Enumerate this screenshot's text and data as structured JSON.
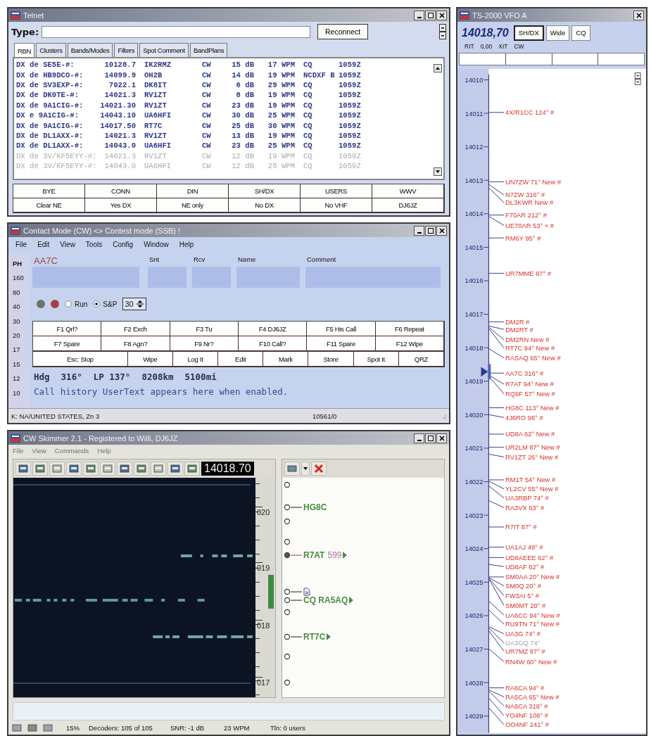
{
  "telnet": {
    "title": "Telnet",
    "type_label": "Type:",
    "reconnect": "Reconnect",
    "tabs": [
      {
        "label": "RBN",
        "selected": true
      },
      {
        "label": "Clusters",
        "selected": false
      },
      {
        "label": "Bands/Modes",
        "selected": false
      },
      {
        "label": "Filters",
        "selected": false
      },
      {
        "label": "Spot Comment",
        "selected": false
      },
      {
        "label": "BandPlans",
        "selected": false
      }
    ],
    "spots": [
      {
        "spotter": "DX de SE5E-#:",
        "freq": "10128.7",
        "call": "IK2RMZ",
        "mode": "CW",
        "snr": "15 dB",
        "speed": "17 WPM",
        "type": "CQ",
        "time": "1059Z",
        "faded": false
      },
      {
        "spotter": "DX de HB9DCO-#:",
        "freq": "14099.9",
        "call": "OH2B",
        "mode": "CW",
        "snr": "14 dB",
        "speed": "19 WPM",
        "type": "NCDXF B",
        "time": "1059Z",
        "faded": false
      },
      {
        "spotter": "DX de SV3EXP-#:",
        "freq": "7022.1",
        "call": "DK8IT",
        "mode": "CW",
        "snr": "6 dB",
        "speed": "29 WPM",
        "type": "CQ",
        "time": "1059Z",
        "faded": false
      },
      {
        "spotter": "DX de DK0TE-#:",
        "freq": "14021.3",
        "call": "RV1ZT",
        "mode": "CW",
        "snr": "8 dB",
        "speed": "19 WPM",
        "type": "CQ",
        "time": "1059Z",
        "faded": false
      },
      {
        "spotter": "DX de 9A1CIG-#:",
        "freq": "14021.30",
        "call": "RV1ZT",
        "mode": "CW",
        "snr": "23 dB",
        "speed": "19 WPM",
        "type": "CQ",
        "time": "1059Z",
        "faded": false
      },
      {
        "spotter": "DX  e 9A1CIG-#:",
        "freq": "14043.10",
        "call": "UA6HFI",
        "mode": "CW",
        "snr": "30 dB",
        "speed": "25 WPM",
        "type": "CQ",
        "time": "1059Z",
        "faded": false
      },
      {
        "spotter": "DX de 9A1CIG-#:",
        "freq": "14017.50",
        "call": "RT7C",
        "mode": "CW",
        "snr": "25 dB",
        "speed": "30 WPM",
        "type": "CQ",
        "time": "1059Z",
        "faded": false
      },
      {
        "spotter": "DX de DL1AXX-#:",
        "freq": "14021.3",
        "call": "RV1ZT",
        "mode": "CW",
        "snr": "13 dB",
        "speed": "19 WPM",
        "type": "CQ",
        "time": "1059Z",
        "faded": false
      },
      {
        "spotter": "DX de DL1AXX-#:",
        "freq": "14043.0",
        "call": "UA6HFI",
        "mode": "CW",
        "snr": "23 dB",
        "speed": "25 WPM",
        "type": "CQ",
        "time": "1059Z",
        "faded": false
      },
      {
        "spotter": "DX de 3V/KF5EYY-#:",
        "freq": "14021.3",
        "call": "RV1ZT",
        "mode": "CW",
        "snr": "12 dB",
        "speed": "19 WPM",
        "type": "CQ",
        "time": "1059Z",
        "faded": true
      },
      {
        "spotter": "DX de 3V/KF5EYY-#:",
        "freq": "14043.0",
        "call": "UA6HFI",
        "mode": "CW",
        "snr": "12 dB",
        "speed": "25 WPM",
        "type": "CQ",
        "time": "1059Z",
        "faded": true
      }
    ],
    "buttons": [
      [
        "BYE",
        "CONN",
        "DIN",
        "SH/DX",
        "USERS",
        "WWV"
      ],
      [
        "Clear NE",
        "Yes DX",
        "NE only",
        "No DX",
        "No VHF",
        "DJ6JZ"
      ]
    ]
  },
  "contact": {
    "title": "Contact Mode (CW) <> Contest mode (SSB) !",
    "menu": [
      "File",
      "Edit",
      "View",
      "Tools",
      "Config",
      "Window",
      "Help"
    ],
    "bands": [
      {
        "label": "PH",
        "selected": true
      },
      {
        "label": "160",
        "selected": false
      },
      {
        "label": "80",
        "selected": false
      },
      {
        "label": "40",
        "selected": false
      },
      {
        "label": "30",
        "selected": false
      },
      {
        "label": "20",
        "selected": false
      },
      {
        "label": "17",
        "selected": false
      },
      {
        "label": "15",
        "selected": false
      },
      {
        "label": "12",
        "selected": false
      },
      {
        "label": "10",
        "selected": false
      }
    ],
    "fields": [
      {
        "label": "AA7C",
        "kind": "call"
      },
      {
        "label": "Snt",
        "kind": "plain"
      },
      {
        "label": "Rcv",
        "kind": "plain"
      },
      {
        "label": "Name",
        "kind": "plain"
      },
      {
        "label": "Comment",
        "kind": "plain"
      }
    ],
    "lights": [
      {
        "color": "#6f7270"
      },
      {
        "color": "#a8403e"
      }
    ],
    "run_modes": [
      {
        "label": "Run",
        "selected": false
      },
      {
        "label": "S&P",
        "selected": true
      }
    ],
    "spin": "30",
    "fkeys": [
      [
        "F1 Qrl?",
        "F2 Exch",
        "F3 Tu",
        "F4 DJ6JZ",
        "F5 His Call",
        "F6 Repeat"
      ],
      [
        "F7 Spare",
        "F8 Agn?",
        "F9 Nr?",
        "F10 Call?",
        "F11 Spare",
        "F12 Wipe"
      ]
    ],
    "actions": [
      "Esc: Stop",
      "Wipe",
      "Log It",
      "Edit",
      "Mark",
      "Store",
      "Spot It",
      "QRZ"
    ],
    "heading": [
      "Hdg",
      "316°",
      "LP 137°",
      "8208km",
      "5100mi"
    ],
    "history": "Call history UserText appears here when enabled.",
    "status": [
      "K: NA/UNITED STATES, Zn 3",
      "10561/0"
    ]
  },
  "skimmer": {
    "title": "CW Skimmer 2.1 - Registered to Willi, DJ6JZ",
    "menu": [
      {
        "label": "File",
        "disabled": true
      },
      {
        "label": "View",
        "disabled": true
      },
      {
        "label": "Commands",
        "disabled": true
      },
      {
        "label": "Help",
        "disabled": true
      }
    ],
    "frequency": "14018.70",
    "scale": [
      "020",
      "019",
      "018",
      "017"
    ],
    "decodes": [
      {
        "kind": "empty",
        "selected": false
      },
      {
        "kind": "call",
        "text": "HG8C",
        "selected": false
      },
      {
        "kind": "empty",
        "selected": false
      },
      {
        "kind": "empty",
        "selected": false
      },
      {
        "kind": "call",
        "text": "R7AT",
        "report": "599",
        "selected": true,
        "arrow": true
      },
      {
        "kind": "note",
        "selected": false
      },
      {
        "kind": "call",
        "text": "CQ RA5AQ",
        "selected": false,
        "arrow": true
      },
      {
        "kind": "empty",
        "selected": false
      },
      {
        "kind": "call",
        "text": "RT7C",
        "selected": false,
        "arrow": true
      },
      {
        "kind": "empty",
        "selected": false
      },
      {
        "kind": "empty",
        "selected": false
      }
    ],
    "status": [
      "15%",
      "Decoders: 105 of 105",
      "SNR: -1 dB",
      "23 WPM",
      "Tln: 0 users"
    ]
  },
  "bandmap": {
    "title": "TS-2000 VFO A",
    "frequency": "14018,70",
    "buttons": [
      {
        "label": "SH/DX",
        "selected": true
      },
      {
        "label": "Wide",
        "selected": false
      },
      {
        "label": "CQ",
        "selected": false
      }
    ],
    "rit": [
      "RIT",
      "0,00",
      "XIT",
      "CW"
    ],
    "ticks": [
      "14010",
      "14011",
      "14012",
      "14013",
      "14014",
      "14015",
      "14016",
      "14017",
      "14018",
      "14019",
      "14020",
      "14021",
      "14022",
      "14023",
      "14024",
      "14025",
      "14026",
      "14027",
      "14028",
      "14029"
    ],
    "spots": [
      {
        "label": "4X/R1CC 124° #",
        "dim": false
      },
      {
        "label": "UN7ZW 71° New #",
        "dim": false
      },
      {
        "label": "N7ZW 316° #",
        "dim": false
      },
      {
        "label": "DL3KWR  New #",
        "dim": false
      },
      {
        "label": "F70AR 212° #",
        "dim": false
      },
      {
        "label": "UE70AR 53° × #",
        "dim": false
      },
      {
        "label": "RM6Y 95° #",
        "dim": false
      },
      {
        "label": "UR7MME 87° #",
        "dim": false
      },
      {
        "label": "DM2R  #",
        "dim": false
      },
      {
        "label": "DM2RT  #",
        "dim": false
      },
      {
        "label": "DM2RN  New #",
        "dim": false
      },
      {
        "label": "RT7C 94° New #",
        "dim": false
      },
      {
        "label": "RASAQ 65° New #",
        "dim": false
      },
      {
        "label": "AA7C 316° #",
        "dim": false
      },
      {
        "label": "R7AT 94° New #",
        "dim": false
      },
      {
        "label": "RQ9F 57° New #",
        "dim": false
      },
      {
        "label": "HG8C 113° New #",
        "dim": false
      },
      {
        "label": "4J6RO 96° #",
        "dim": false
      },
      {
        "label": "UD8A 62° New #",
        "dim": false
      },
      {
        "label": "UR2LM 87° New #",
        "dim": false
      },
      {
        "label": "RV1ZT 26° New #",
        "dim": false
      },
      {
        "label": "RM1T 54° New #",
        "dim": false
      },
      {
        "label": "YL2CV 55° New #",
        "dim": false
      },
      {
        "label": "UA3RBP 74° #",
        "dim": false
      },
      {
        "label": "RA3VX 63° #",
        "dim": false
      },
      {
        "label": "R7IT 87° #",
        "dim": false
      },
      {
        "label": "UA1AJ 49° #",
        "dim": false
      },
      {
        "label": "UD8AEEE 62° #",
        "dim": false
      },
      {
        "label": "UD8AF 62° #",
        "dim": false
      },
      {
        "label": "SM0AA 20° New #",
        "dim": false
      },
      {
        "label": "SM0Q 20° #",
        "dim": false
      },
      {
        "label": "FW3AI 5° #",
        "dim": false
      },
      {
        "label": "SM0MT 20° #",
        "dim": false
      },
      {
        "label": "UA6CC 94° New #",
        "dim": false
      },
      {
        "label": "RU9TN 71° New #",
        "dim": false
      },
      {
        "label": "UA3G 74° #",
        "dim": false
      },
      {
        "label": "UA3GQ 74°",
        "dim": true
      },
      {
        "label": "UR7MZ 87° #",
        "dim": false
      },
      {
        "label": "RN4W 60° New #",
        "dim": false
      },
      {
        "label": "RA6CA 94° #",
        "dim": false
      },
      {
        "label": "RA5CA 65° New #",
        "dim": false
      },
      {
        "label": "NA6CA 318° #",
        "dim": false
      },
      {
        "label": "YO4NF 108° #",
        "dim": false
      },
      {
        "label": "OO4NF 241° #",
        "dim": false
      }
    ]
  }
}
